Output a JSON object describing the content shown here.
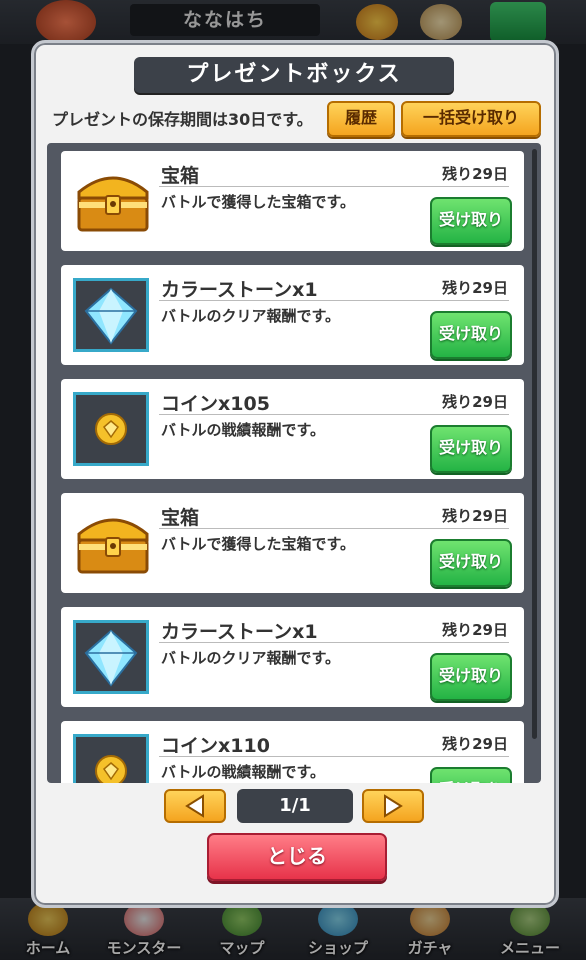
{
  "header": {
    "title": "ななはち"
  },
  "nav": [
    {
      "label": "ホーム"
    },
    {
      "label": "モンスター"
    },
    {
      "label": "マップ"
    },
    {
      "label": "ショップ"
    },
    {
      "label": "ガチャ"
    },
    {
      "label": "メニュー"
    }
  ],
  "modal": {
    "title": "プレゼントボックス",
    "storage_note": "プレゼントの保存期間は30日です。",
    "history_label": "履歴",
    "receive_all_label": "一括受け取り",
    "page_indicator": "1/1",
    "close_label": "とじる"
  },
  "items": [
    {
      "name": "宝箱",
      "desc": "バトルで獲得した宝箱です。",
      "remaining": "残り29日",
      "button": "受け取り",
      "icon": "treasure-chest-icon"
    },
    {
      "name": "カラーストーンx1",
      "desc": "バトルのクリア報酬です。",
      "remaining": "残り29日",
      "button": "受け取り",
      "icon": "diamond-icon"
    },
    {
      "name": "コインx105",
      "desc": "バトルの戦績報酬です。",
      "remaining": "残り29日",
      "button": "受け取り",
      "icon": "coin-icon"
    },
    {
      "name": "宝箱",
      "desc": "バトルで獲得した宝箱です。",
      "remaining": "残り29日",
      "button": "受け取り",
      "icon": "treasure-chest-icon"
    },
    {
      "name": "カラーストーンx1",
      "desc": "バトルのクリア報酬です。",
      "remaining": "残り29日",
      "button": "受け取り",
      "icon": "diamond-icon"
    },
    {
      "name": "コインx110",
      "desc": "バトルの戦績報酬です。",
      "remaining": "残り29日",
      "button": "受け取り",
      "icon": "coin-icon"
    }
  ],
  "colors": {
    "accent_yellow": "#f4a41f",
    "receive_green": "#24b345",
    "close_red": "#e7334a",
    "frame_cyan": "#37a9c9"
  }
}
